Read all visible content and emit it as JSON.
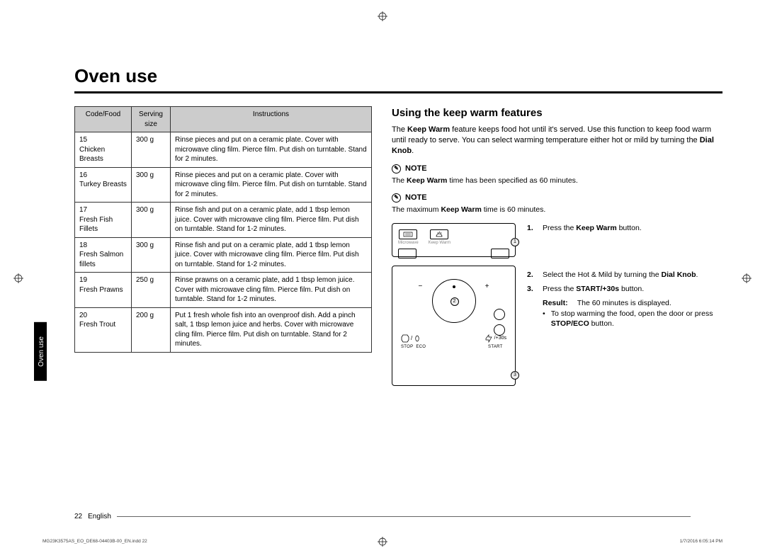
{
  "page_title": "Oven use",
  "side_tab": "Oven use",
  "table": {
    "headers": {
      "code": "Code/Food",
      "size": "Serving size",
      "instr": "Instructions"
    },
    "rows": [
      {
        "code": "15",
        "food": "Chicken Breasts",
        "size": "300 g",
        "instr": "Rinse pieces and put on a ceramic plate. Cover with microwave cling film. Pierce film. Put dish on turntable. Stand for 2 minutes."
      },
      {
        "code": "16",
        "food": "Turkey Breasts",
        "size": "300 g",
        "instr": "Rinse pieces and put on a ceramic plate. Cover with microwave cling film. Pierce film. Put dish on turntable. Stand for 2 minutes."
      },
      {
        "code": "17",
        "food": "Fresh Fish Fillets",
        "size": "300 g",
        "instr": "Rinse fish and put on a ceramic plate, add 1 tbsp lemon juice. Cover with microwave cling film. Pierce film. Put dish on turntable. Stand for 1-2 minutes."
      },
      {
        "code": "18",
        "food": "Fresh Salmon fillets",
        "size": "300 g",
        "instr": "Rinse fish and put on a ceramic plate, add 1 tbsp lemon juice. Cover with microwave cling film. Pierce film. Put dish on turntable. Stand for 1-2 minutes."
      },
      {
        "code": "19",
        "food": "Fresh Prawns",
        "size": "250 g",
        "instr": "Rinse prawns on a ceramic plate, add 1 tbsp lemon juice. Cover with microwave cling film. Pierce film. Put dish on turntable. Stand for 1-2 minutes."
      },
      {
        "code": "20",
        "food": "Fresh Trout",
        "size": "200 g",
        "instr": "Put 1 fresh whole fish into an ovenproof dish. Add a pinch salt, 1 tbsp lemon juice and herbs. Cover with microwave cling film. Pierce film. Put dish on turntable. Stand for 2 minutes."
      }
    ]
  },
  "right": {
    "heading": "Using the keep warm features",
    "intro_pre": "The ",
    "intro_bold": "Keep Warm",
    "intro_post": " feature keeps food hot until it's served. Use this function to keep food warm until ready to serve. You can select warming temperature either hot or mild by turning the ",
    "intro_bold2": "Dial Knob",
    "intro_end": ".",
    "note_label": "NOTE",
    "note1_pre": "The ",
    "note1_bold": "Keep Warm",
    "note1_post": " time has been specified as 60 minutes.",
    "note2_pre": "The maximum ",
    "note2_bold": "Keep Warm",
    "note2_post": " time is 60 minutes.",
    "panel_labels": {
      "microwave": "Microwave",
      "keep_warm": "Keep Warm",
      "stop": "STOP",
      "eco": "ECO",
      "start": "START",
      "plus30": "/+30s"
    },
    "steps": [
      {
        "n": "1.",
        "pre": "Press the ",
        "bold": "Keep Warm",
        "post": " button."
      },
      {
        "n": "2.",
        "pre": "Select the Hot & Mild by turning the ",
        "bold": "Dial Knob",
        "post": "."
      },
      {
        "n": "3.",
        "pre": "Press the ",
        "bold": "START/+30s",
        "post": " button."
      }
    ],
    "result_label": "Result:",
    "result_text": "The 60 minutes is displayed.",
    "stop_bullet_pre": "To stop warming the food, open the door or press ",
    "stop_bullet_bold": "STOP/ECO",
    "stop_bullet_post": " button."
  },
  "callouts": {
    "c1": "1",
    "c2": "2",
    "c3": "3"
  },
  "footer": {
    "page_no": "22",
    "lang": "English",
    "file": "MG23K3575AS_EO_DE68-04403B-00_EN.indd   22",
    "timestamp": "1/7/2016   6:05:14 PM"
  }
}
